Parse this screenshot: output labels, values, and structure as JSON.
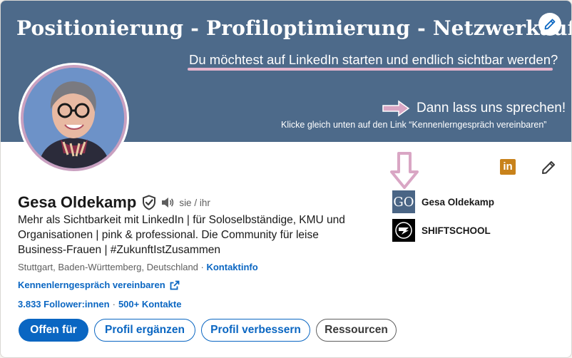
{
  "banner": {
    "title": "Positionierung - Profiloptimierung - Netzwerkaufbau",
    "subtitle": "Du möchtest auf  LinkedIn starten und endlich sichtbar werden?",
    "cta": "Dann lass uns sprechen!",
    "hint": "Klicke gleich unten auf den Link  “Kennenlerngespräch vereinbaren”",
    "accent_color": "#e6b4cd",
    "background_color": "#4d6a8a"
  },
  "profile": {
    "name": "Gesa Oldekamp",
    "pronouns": "sie / ihr",
    "headline": "Mehr als Sichtbarkeit mit LinkedIn | für Soloselbständige, KMU und Organisationen | pink & professional. Die Community für leise Business-Frauen | #ZukunftIstZusammen",
    "location": "Stuttgart, Baden-Württemberg, Deutschland",
    "location_sep": " · ",
    "contact_info": "Kontaktinfo",
    "booking_link": "Kennenlerngespräch vereinbaren",
    "followers": "3.833 Follower:innen",
    "stats_sep": "·",
    "connections": "500+ Kontakte"
  },
  "actions": {
    "open_to": "Offen für",
    "add_section": "Profil ergänzen",
    "enhance_profile": "Profil verbessern",
    "resources": "Ressourcen"
  },
  "organizations": [
    {
      "logo_text": "GO",
      "name": "Gesa Oldekamp"
    },
    {
      "logo_text": "",
      "name": "SHIFTSCHOOL"
    }
  ],
  "icons": {
    "linkedin_badge": "in",
    "edit_banner": "pencil-icon",
    "edit_profile": "pencil-icon",
    "verified": "shield-check-icon",
    "pronunciation": "speaker-icon",
    "external_link": "external-link-icon"
  },
  "colors": {
    "link_blue": "#0a66c2",
    "avatar_ring": "#c9a0c0",
    "pink_arrow": "#d9a6c4",
    "linkedin_badge": "#c8821a"
  }
}
